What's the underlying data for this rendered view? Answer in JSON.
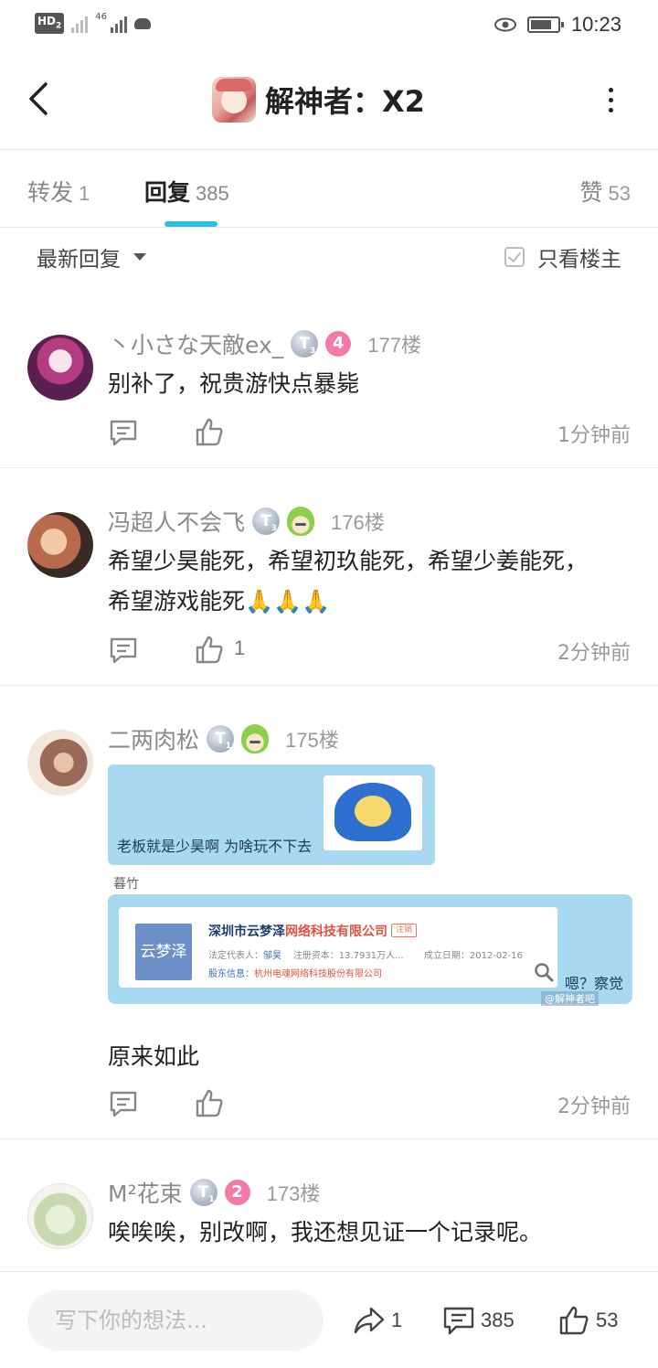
{
  "status_bar": {
    "hd_label": "HD",
    "hd_sub": "2",
    "network": "46",
    "time": "10:23"
  },
  "header": {
    "title": "解神者：X2"
  },
  "tabs": [
    {
      "label": "转发",
      "count": "1"
    },
    {
      "label": "回复",
      "count": "385",
      "active": true
    },
    {
      "label": "赞",
      "count": "53"
    }
  ],
  "filter": {
    "sort_label": "最新回复",
    "only_op_label": "只看楼主"
  },
  "replies": [
    {
      "username": "丶小さな天敵ex_",
      "badge_t": "T",
      "badge_t_level": "3",
      "level": "4",
      "floor": "177楼",
      "content": "别补了，祝贵游快点暴毙",
      "likes": "",
      "time": "1分钟前"
    },
    {
      "username": "冯超人不会飞",
      "badge_t": "T",
      "badge_t_level": "3",
      "floor": "176楼",
      "content": "希望少昊能死，希望初玖能死，希望少姜能死，希望游戏能死🙏🙏🙏",
      "likes": "1",
      "time": "2分钟前"
    },
    {
      "username": "二两肉松",
      "badge_t": "T",
      "badge_t_level": "1",
      "floor": "175楼",
      "image": {
        "chat_text": "老板就是少昊啊 为啥玩不下去",
        "sender_name": "暮竹",
        "card_logo_text": "云梦泽",
        "card_title_prefix": "深圳市云梦泽",
        "card_title_highlight": "网络科技有限公司",
        "card_tag": "注销",
        "legal_rep_label": "法定代表人：",
        "legal_rep": "邹昊",
        "capital_label": "注册资本：",
        "capital": "13.7931万人...",
        "founded_label": "成立日期：",
        "founded": "2012-02-16",
        "shareholder_label": "股东信息：",
        "shareholder": "杭州电魂网络科技股份有限公司",
        "caption": "嗯？察觉",
        "watermark": "@解神者吧"
      },
      "content": "原来如此",
      "likes": "",
      "time": "2分钟前"
    },
    {
      "username": "M²花束",
      "badge_t": "T",
      "badge_t_level": "1",
      "level": "2",
      "floor": "173楼",
      "content": "唉唉唉，别改啊，我还想见证一个记录呢。"
    }
  ],
  "bottom_bar": {
    "input_placeholder": "写下你的想法...",
    "share_count": "1",
    "comment_count": "385",
    "like_count": "53"
  },
  "colors": {
    "accent": "#29bde8",
    "level_badge": "#f27aa6",
    "chat_bubble": "#a8d8f2"
  }
}
